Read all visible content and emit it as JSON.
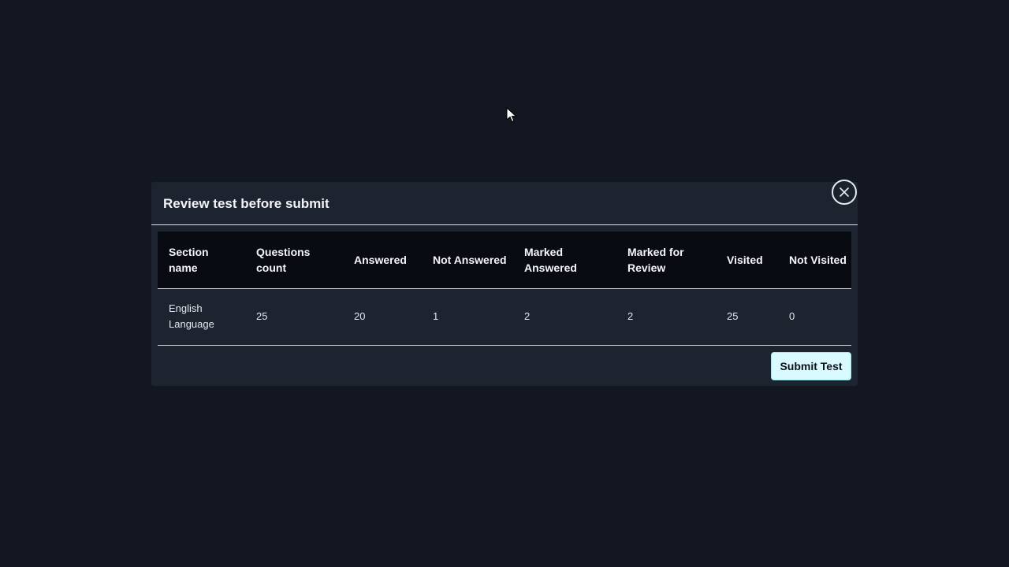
{
  "modal": {
    "title": "Review test before submit",
    "close_icon": "close-icon",
    "submit_label": "Submit Test"
  },
  "table": {
    "headers": [
      "Section name",
      "Questions count",
      "Answered",
      "Not Answered",
      "Marked Answered",
      "Marked for Review",
      "Visited",
      "Not Visited"
    ],
    "rows": [
      {
        "section_name": "English Language",
        "questions_count": "25",
        "answered": "20",
        "not_answered": "1",
        "marked_answered": "2",
        "marked_for_review": "2",
        "visited": "25",
        "not_visited": "0"
      }
    ]
  },
  "colors": {
    "background": "#121722",
    "modal": "#1d2430",
    "header_row": "#080b11",
    "submit_button": "#d9fbff"
  }
}
